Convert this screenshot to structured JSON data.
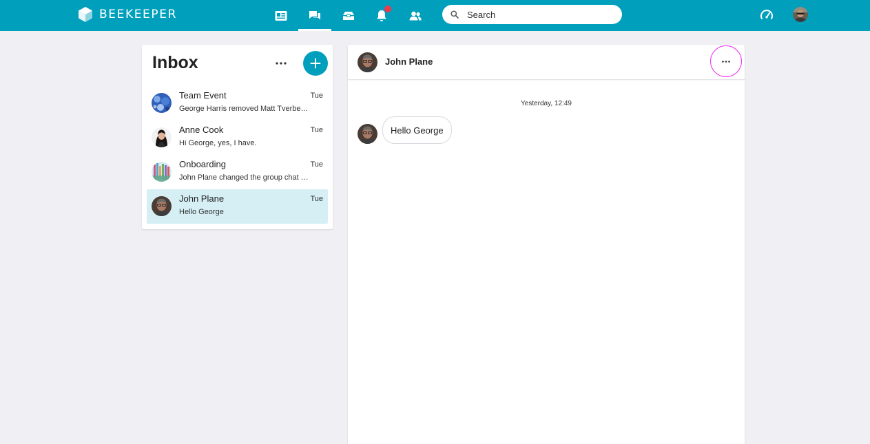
{
  "topbar": {
    "brand": "BEEKEEPER",
    "nav": [
      {
        "icon": "newsfeed-icon"
      },
      {
        "icon": "chat-icon",
        "active": true
      },
      {
        "icon": "tools-icon"
      },
      {
        "icon": "bell-icon",
        "has_notification": true
      },
      {
        "icon": "people-icon"
      }
    ],
    "search": {
      "placeholder": "Search",
      "value": ""
    },
    "right_icons": [
      "speedometer-icon",
      "user-avatar"
    ],
    "colors": {
      "brand": "#00a0bd",
      "notification": "#f0394b"
    }
  },
  "inbox": {
    "title": "Inbox",
    "conversations": [
      {
        "name": "Team Event",
        "time": "Tue",
        "preview": "George Harris removed Matt Tverbe…",
        "avatar": "group-blue"
      },
      {
        "name": "Anne Cook",
        "time": "Tue",
        "preview": "Hi George, yes, I have.",
        "avatar": "woman"
      },
      {
        "name": "Onboarding",
        "time": "Tue",
        "preview": "John Plane changed the group chat …",
        "avatar": "group-colorful"
      },
      {
        "name": "John Plane",
        "time": "Tue",
        "preview": "Hello George",
        "avatar": "man",
        "selected": true
      }
    ]
  },
  "chat": {
    "contact_name": "John Plane",
    "date_divider": "Yesterday, 12:49",
    "messages": [
      {
        "text": "Hello George",
        "from": "John Plane"
      }
    ],
    "colors": {
      "more_highlight": "#ee33ee",
      "selected_row": "#d5eff4"
    }
  }
}
